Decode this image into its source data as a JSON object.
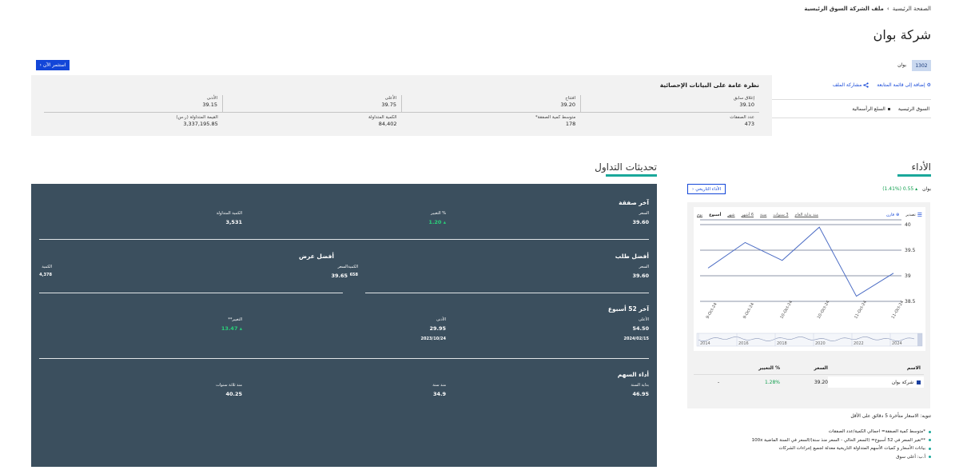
{
  "breadcrumb": {
    "home": "الصفحة الرئيسية",
    "separator": "›",
    "current": "ملف الشركة السوق الرئيسية"
  },
  "page_title": "شركة بوان",
  "invest_button": "استثمر الآن",
  "symbol": {
    "code": "1302",
    "name": "بوان"
  },
  "links": {
    "watchlist": "إضافة إلى قائمة المتابعة",
    "share": "مشاركة الملف"
  },
  "market": {
    "name": "السوق الرئيسية",
    "sector": "السلع الرأسمالية"
  },
  "stats": {
    "title": "نظرة عامة على البيانات الإحصائية",
    "row1": [
      {
        "label": "إغلاق سابق",
        "value": "39.10"
      },
      {
        "label": "افتتاح",
        "value": "39.20"
      },
      {
        "label": "الأعلى",
        "value": "39.75"
      },
      {
        "label": "الأدنى",
        "value": "39.15"
      }
    ],
    "row2": [
      {
        "label": "عدد الصفقات",
        "value": "473"
      },
      {
        "label": "متوسط كمية الصفقة*",
        "value": "178"
      },
      {
        "label": "الكمية المتداولة",
        "value": "84,402"
      },
      {
        "label": "القيمة المتداولة (ر.س)",
        "value": "3,337,195.85"
      }
    ]
  },
  "performance": {
    "heading": "الأداء",
    "name": "بوان",
    "change": "0.55 (1.41%)",
    "historical_button": "الأداء التاريخي",
    "toolbar": {
      "menu": "تصدير",
      "compare": "قارن",
      "periods": [
        "منذ بداية العام",
        "3 سنوات",
        "سنة",
        "6 أشهر",
        "شهر",
        "أسبوع",
        "يوم"
      ],
      "active_period": "أسبوع"
    },
    "table": {
      "headers": {
        "name": "الاسم",
        "price": "السعر",
        "change": "% التغيير"
      },
      "rows": [
        {
          "name": "شركة بوان",
          "price": "39.20",
          "change": "1.28%",
          "extra": "-"
        }
      ]
    }
  },
  "chart_data": {
    "type": "line",
    "x": [
      "9-Oct-24",
      "9-Oct-24",
      "10-Oct-24",
      "10-Oct-24",
      "11-Oct-24",
      "11-Oct-24"
    ],
    "values": [
      39.15,
      39.65,
      39.3,
      39.95,
      38.6,
      39.05
    ],
    "ylim": [
      38.5,
      40
    ],
    "yticks": [
      "40",
      "39.5",
      "39",
      "38.5"
    ],
    "navigator_years": [
      "2014",
      "2016",
      "2018",
      "2020",
      "2022",
      "2024"
    ],
    "line_color": "#4a6bc4",
    "grid": true
  },
  "note": "تنويه: الاسعار متأخرة 5 دقائق على الأقل",
  "bullets": [
    "*متوسط كمية الصفقة= اجمالي الكمية/عدد الصفقات",
    "**تغير السعر في 52 أسبوع= (السعر الحالي - السعر منذ سنة)/السعر في السنة الماضية 100x",
    "بيانات الأسعار و كميات الأسهم المتداولة التاريخية معدلة لجميع إجراءات الشركات",
    "أ.ب: أعلى سوق"
  ],
  "trading": {
    "heading": "تحديثات التداول",
    "last_trade": {
      "title": "آخر صفقة",
      "price_label": "السعر",
      "price": "39.60",
      "change_label": "% التغيير",
      "change": "1.20",
      "volume_label": "الكمية المتداولة",
      "volume": "3,531"
    },
    "best_bid": {
      "title": "أفضل طلب",
      "price_label": "السعر",
      "price": "39.60",
      "qty_label": "الكمية",
      "qty": "658"
    },
    "best_offer": {
      "title": "أفضل عرض",
      "price_label": "السعر",
      "price": "39.65",
      "qty_label": "الكمية",
      "qty": "4,378"
    },
    "week52": {
      "title": "آخر 52 أسبوع",
      "high_label": "الأعلى",
      "high": "54.50",
      "high_date": "2024/02/15",
      "low_label": "الأدنى",
      "low": "29.95",
      "low_date": "2023/10/24",
      "change_label": "التغيير**",
      "change": "13.47"
    },
    "stock_perf": {
      "title": "أداء السهم",
      "ytd_label": "بداية السنة",
      "ytd": "46.95",
      "year_label": "منذ سنة",
      "year": "34.9",
      "three_label": "منذ ثلاثة سنوات",
      "three": "40.25"
    }
  }
}
